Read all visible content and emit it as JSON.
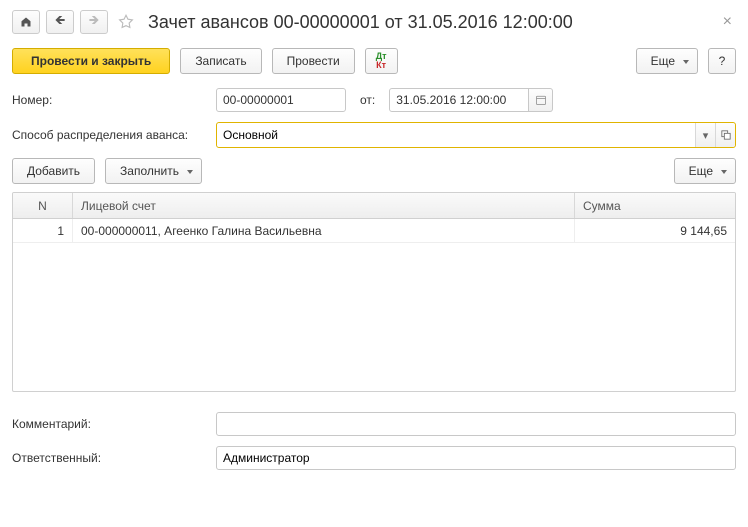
{
  "title": "Зачет авансов 00-00000001 от 31.05.2016 12:00:00",
  "toolbar": {
    "post_close": "Провести и закрыть",
    "write": "Записать",
    "post": "Провести",
    "more": "Еще",
    "help": "?"
  },
  "fields": {
    "number_label": "Номер:",
    "number_value": "00-00000001",
    "from_label": "от:",
    "date_value": "31.05.2016 12:00:00",
    "dist_label": "Способ распределения аванса:",
    "dist_value": "Основной"
  },
  "table_toolbar": {
    "add": "Добавить",
    "fill": "Заполнить",
    "more": "Еще"
  },
  "grid": {
    "columns": {
      "n": "N",
      "account": "Лицевой счет",
      "sum": "Сумма"
    },
    "rows": [
      {
        "n": "1",
        "account": "00-000000011, Агеенко Галина Васильевна",
        "sum": "9 144,65"
      }
    ]
  },
  "footer": {
    "comment_label": "Комментарий:",
    "comment_value": "",
    "responsible_label": "Ответственный:",
    "responsible_value": "Администратор"
  }
}
